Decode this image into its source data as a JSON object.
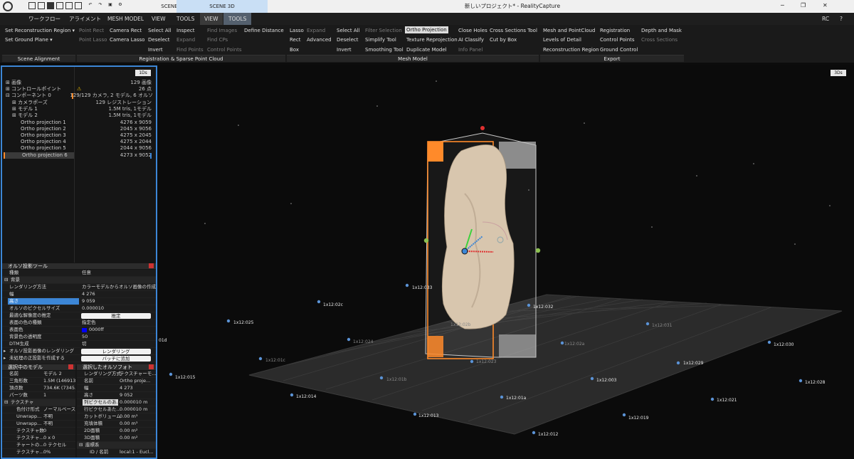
{
  "window": {
    "title": "新しいプロジェクト* - RealityCapture",
    "scene_tabs": [
      "SCENE 1D",
      "SCENE 3D"
    ],
    "user": "RC",
    "controls": [
      "─",
      "❐",
      "✕"
    ]
  },
  "menubar": {
    "items": [
      "ワークフロー",
      "アライメント",
      "MESH MODEL",
      "VIEW",
      "TOOLS",
      "VIEW",
      "TOOLS"
    ]
  },
  "ribbon": {
    "scene_alignment": {
      "label": "Scene Alignment",
      "items": [
        "Set Reconstruction Region ▾",
        "Set Ground Plane ▾"
      ]
    },
    "registration": {
      "label": "Registration & Sparse Point Cloud",
      "items": [
        "Point Rect",
        "Camera Rect",
        "Select All",
        "Inspect",
        "Find Images",
        "Define Distance",
        "Point Lasso",
        "Camera Lasso",
        "Deselect",
        "Expand",
        "Find CPs",
        "Invert",
        "Find Points",
        "Control Points"
      ]
    },
    "mesh_model": {
      "label": "Mesh Model",
      "items": [
        "Lasso",
        "Expand",
        "Select All",
        "Filter Selection",
        "Ortho Projection",
        "Close Holes",
        "Cross Sections Tool",
        "Rect",
        "Advanced",
        "Deselect",
        "Simplify Tool",
        "Texture Reprojection",
        "AI Classify",
        "Cut by Box",
        "Box",
        "Invert",
        "Smoothing Tool",
        "Duplicate Model",
        "Info Panel"
      ]
    },
    "export": {
      "label": "Export",
      "items": [
        "Mesh and PointCloud",
        "Registration",
        "Depth and Mask",
        "Levels of Detail",
        "Control Points",
        "Cross Sections",
        "Reconstruction Region",
        "Ground Control"
      ]
    }
  },
  "tree": {
    "view_btn": "1Ds",
    "items": [
      "画像",
      "コントロールポイント",
      "コンポーネント 0",
      "カメラポーズ",
      "モデル 1",
      "モデル 2",
      "Ortho projection 1",
      "Ortho projection 2",
      "Ortho projection 3",
      "Ortho projection 4",
      "Ortho projection 5",
      "Ortho projection 6"
    ],
    "values": [
      "129 画像",
      "26 点",
      "129/129 カメラ, 2 モデル, 6 オルソ",
      "129 レジストレーション",
      "1.5M tris, 1モデル",
      "1.5M tris, 1モデル",
      "4276 x 9059",
      "2045 x 9056",
      "4275 x 2045",
      "4275 x 2044",
      "2044 x 9056",
      "4273 x 9052"
    ]
  },
  "ortho_tool": {
    "title": "オルソ投影ツール",
    "rows": [
      [
        "種類",
        "任意"
      ],
      [
        "背景",
        ""
      ],
      [
        "レンダリング方法",
        "カラーモデルからオルソ画像の作成"
      ],
      [
        "幅",
        "4 276"
      ],
      [
        "高さ",
        "9 059"
      ],
      [
        "オルソのピクセルサイズ",
        "0.000010"
      ],
      [
        "最適な解像度の推定",
        "推定"
      ],
      [
        "表面の色の種類",
        "指定色"
      ],
      [
        "表面色",
        "0000ff"
      ],
      [
        "背景色の透明度",
        "50"
      ],
      [
        "DTM生成",
        "切"
      ],
      [
        "オルソ投影画像のレンダリング",
        "レンダリング"
      ],
      [
        "未処理の正投影を作成する",
        "バッチに追加"
      ]
    ]
  },
  "selected_model": {
    "title": "選択中のモデル",
    "rows": [
      [
        "名前",
        "モデル 2"
      ],
      [
        "三角形数",
        "1.5M (1469136)"
      ],
      [
        "頂点数",
        "734.6K (7345..."
      ],
      [
        "パーツ数",
        "1"
      ],
      [
        "テクスチャ",
        ""
      ],
      [
        "色付け形式",
        "ノーマルベース"
      ],
      [
        "Unwrapp...",
        "不明"
      ],
      [
        "Unwrapp...",
        "不明"
      ],
      [
        "テクスチャ数",
        "0"
      ],
      [
        "テクスチャ...",
        "0 x 0"
      ],
      [
        "チャートの...",
        "0 テクセル"
      ],
      [
        "テクスチャ...",
        "0%"
      ]
    ]
  },
  "selected_ortho": {
    "title": "選択したオルソフォト",
    "rows": [
      [
        "レンダリング方式",
        "テクスチャーモ..."
      ],
      [
        "名前",
        "Ortho proje..."
      ],
      [
        "幅",
        "4 273"
      ],
      [
        "高さ",
        "9 052"
      ],
      [
        "列ピクセルのあ...",
        "0.000010 m"
      ],
      [
        "行ピクセルあた...",
        "0.000010 m"
      ],
      [
        "カットボリューム",
        "0.00 m³"
      ],
      [
        "充填体積",
        "0.00 m³"
      ],
      [
        "2D面積",
        "0.00 m²"
      ],
      [
        "3D面積",
        "0.00 m²"
      ],
      [
        "座標系",
        ""
      ],
      [
        "ID / 名前",
        "local:1 - Eucl..."
      ]
    ]
  },
  "viewport": {
    "view_btn": "3Ds",
    "left_edge_label": "01d",
    "labels": [
      "1x12:033",
      "1x12:02c",
      "1x12:032",
      "1x12:025",
      "1x12:031",
      "1x12:024",
      "1x12:02a",
      "1x12:02b",
      "1x12:030",
      "1x12:01c",
      "1x12:023",
      "1x12:029",
      "1x12:015",
      "1x12:01b",
      "1x12:003",
      "1x12:028",
      "1x12:014",
      "1x12:01a",
      "1x12:021",
      "1x12:013",
      "1x12:019",
      "1x12:012"
    ]
  },
  "colors": {
    "accent": "#3c86d6",
    "selection": "#ff8a2a",
    "ribbon_bg": "#1a1a1a",
    "model": "#d8c6ae"
  }
}
